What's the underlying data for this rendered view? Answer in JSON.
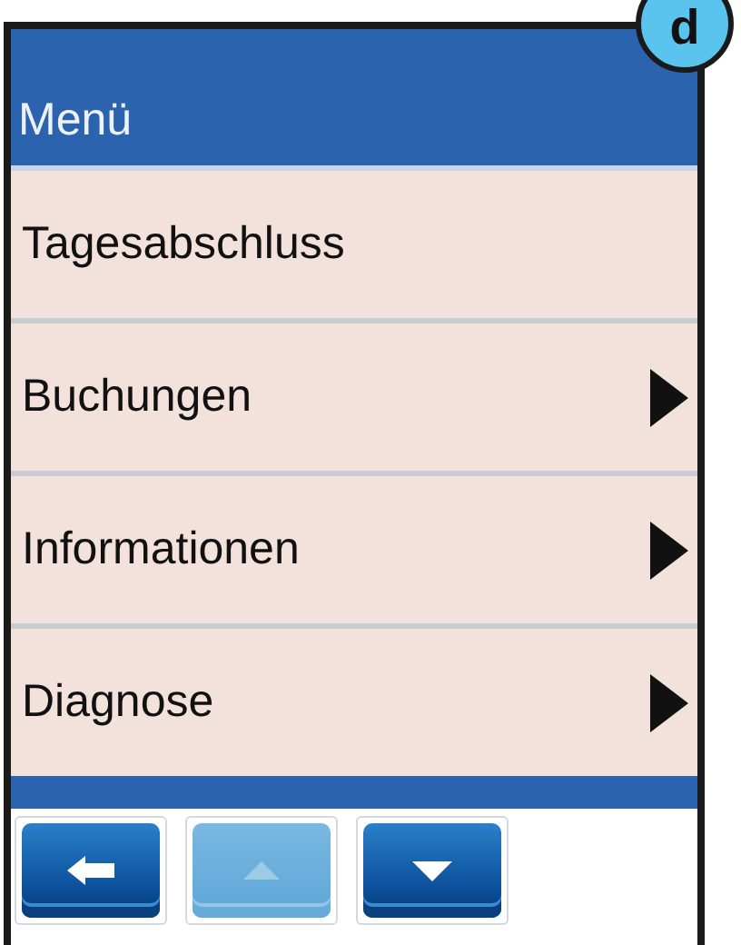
{
  "badge": "d",
  "header": {
    "title": "Menü"
  },
  "items": [
    {
      "label": "Tagesabschluss",
      "has_submenu": false
    },
    {
      "label": "Buchungen",
      "has_submenu": true
    },
    {
      "label": "Informationen",
      "has_submenu": true
    },
    {
      "label": "Diagnose",
      "has_submenu": true
    }
  ],
  "buttons": [
    {
      "kind": "back",
      "disabled": false
    },
    {
      "kind": "up",
      "disabled": true
    },
    {
      "kind": "down",
      "disabled": false
    }
  ]
}
